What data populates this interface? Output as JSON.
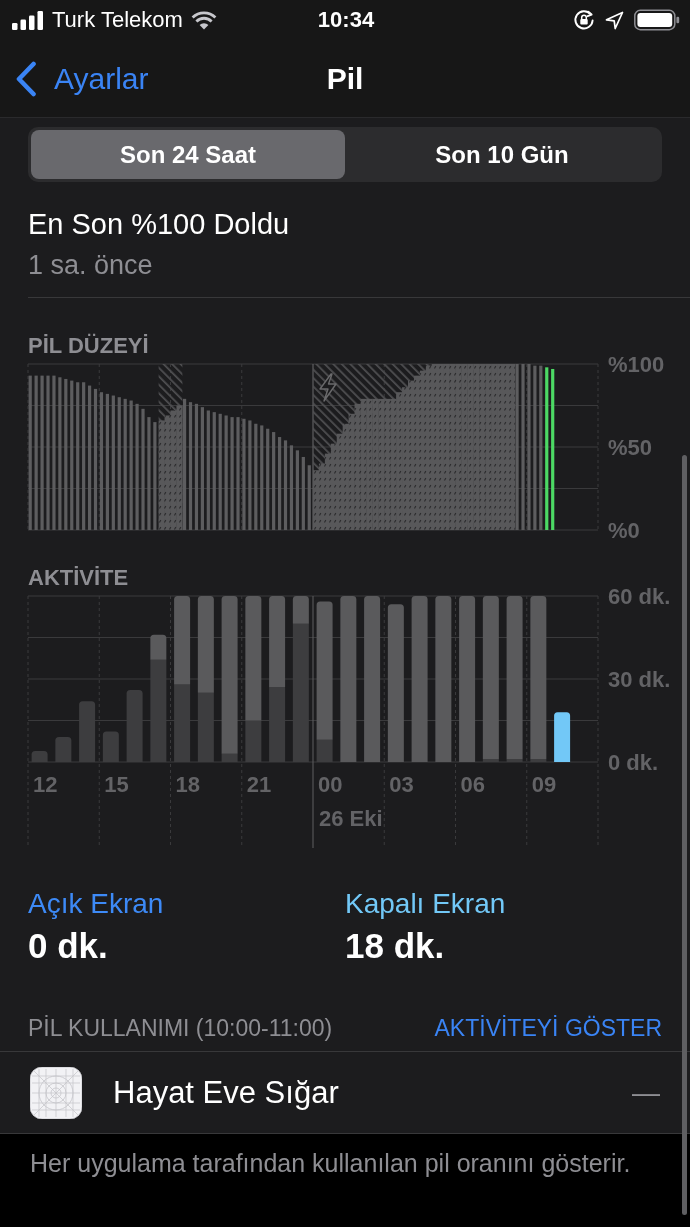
{
  "status_bar": {
    "carrier": "Turk Telekom",
    "time": "10:34"
  },
  "nav": {
    "back": "Ayarlar",
    "title": "Pil"
  },
  "segments": [
    {
      "label": "Son 24 Saat",
      "selected": true
    },
    {
      "label": "Son 10 Gün",
      "selected": false
    }
  ],
  "last_charge": {
    "title": "En Son %100 Doldu",
    "subtitle": "1 sa. önce"
  },
  "battery_level": {
    "title": "PİL DÜZEYİ",
    "chart_data": {
      "type": "bar",
      "stacked": true,
      "ylim": [
        0,
        100
      ],
      "yticks": [
        {
          "value": 100,
          "label": "%100"
        },
        {
          "value": 50,
          "label": "%50"
        },
        {
          "value": 0,
          "label": "%0"
        }
      ],
      "series": [
        {
          "color": "#5d5d5f",
          "values": [
            93,
            93,
            93,
            93,
            93,
            92,
            91,
            90,
            89,
            89,
            87,
            85,
            83,
            82,
            81,
            80,
            79,
            78,
            76,
            73,
            68,
            65,
            null,
            null,
            null,
            null,
            79,
            77,
            76,
            74,
            72,
            71,
            70,
            69,
            68,
            68,
            67,
            66,
            64,
            63,
            61,
            59,
            56,
            54,
            51,
            48,
            44,
            39,
            null,
            null,
            null,
            null,
            null,
            null,
            null,
            null,
            null,
            null,
            null,
            null,
            null,
            null,
            null,
            null,
            null,
            null,
            null,
            null,
            null,
            null,
            null,
            null,
            null,
            null,
            null,
            null,
            null,
            null,
            null,
            null,
            null,
            null,
            100,
            100,
            100,
            99,
            99,
            null,
            null,
            null,
            null,
            null,
            null,
            null,
            null,
            null
          ]
        },
        {
          "color": "#58585a",
          "values": [
            null,
            null,
            null,
            null,
            null,
            null,
            null,
            null,
            null,
            null,
            null,
            null,
            null,
            null,
            null,
            null,
            null,
            null,
            null,
            null,
            null,
            null,
            66,
            69,
            72,
            75,
            null,
            null,
            null,
            null,
            null,
            null,
            null,
            null,
            null,
            null,
            null,
            null,
            null,
            null,
            null,
            null,
            null,
            null,
            null,
            null,
            null,
            null,
            36,
            40,
            46,
            52,
            58,
            64,
            70,
            76,
            79,
            79,
            79,
            79,
            79,
            79,
            83,
            86,
            90,
            93,
            96,
            99,
            100,
            100,
            100,
            100,
            100,
            100,
            100,
            100,
            100,
            100,
            100,
            100,
            100,
            100,
            null,
            null,
            null,
            null,
            null,
            null,
            null,
            null,
            null,
            null,
            null,
            null,
            null,
            null
          ]
        },
        {
          "color": "#4cd964",
          "values": [
            null,
            null,
            null,
            null,
            null,
            null,
            null,
            null,
            null,
            null,
            null,
            null,
            null,
            null,
            null,
            null,
            null,
            null,
            null,
            null,
            null,
            null,
            null,
            null,
            null,
            null,
            null,
            null,
            null,
            null,
            null,
            null,
            null,
            null,
            null,
            null,
            null,
            null,
            null,
            null,
            null,
            null,
            null,
            null,
            null,
            null,
            null,
            null,
            null,
            null,
            null,
            null,
            null,
            null,
            null,
            null,
            null,
            null,
            null,
            null,
            null,
            null,
            null,
            null,
            null,
            null,
            null,
            null,
            null,
            null,
            null,
            null,
            null,
            null,
            null,
            null,
            null,
            null,
            null,
            null,
            null,
            null,
            null,
            null,
            null,
            null,
            null,
            98,
            97,
            null,
            null,
            null,
            null,
            null,
            null,
            null
          ]
        }
      ]
    }
  },
  "activity": {
    "title": "AKTİVİTE",
    "chart_data": {
      "type": "bar",
      "stacked": true,
      "categories": [
        "12",
        null,
        null,
        "15",
        null,
        null,
        "18",
        null,
        null,
        "21",
        null,
        null,
        "00",
        null,
        null,
        "03",
        null,
        null,
        "06",
        null,
        null,
        "09",
        null,
        null
      ],
      "ylim": [
        0,
        60
      ],
      "yticks": [
        {
          "value": 60,
          "label": "60 dk."
        },
        {
          "value": 30,
          "label": "30 dk."
        },
        {
          "value": 0,
          "label": "0 dk."
        }
      ],
      "series": [
        {
          "name": "Açık Ekran",
          "color": "#3d8af7",
          "values": [
            null,
            null,
            null,
            null,
            null,
            null,
            null,
            null,
            null,
            null,
            null,
            null,
            null,
            null,
            null,
            null,
            null,
            null,
            null,
            null,
            null,
            null,
            0,
            null
          ]
        },
        {
          "name": "Kapalı Ekran",
          "color": "#72c8f7",
          "values": [
            null,
            null,
            null,
            null,
            null,
            null,
            null,
            null,
            null,
            null,
            null,
            null,
            null,
            null,
            null,
            null,
            null,
            null,
            null,
            null,
            null,
            null,
            18,
            null
          ]
        },
        {
          "color": "#3d3d3f",
          "values": [
            4,
            9,
            22,
            11,
            26,
            37,
            28,
            25,
            3,
            15,
            27,
            50,
            8,
            0,
            0,
            0,
            0,
            0,
            0,
            1,
            1,
            1,
            null,
            null
          ]
        },
        {
          "color": "#5a5a5c",
          "values": [
            0,
            0,
            0,
            0,
            0,
            9,
            32,
            35,
            57,
            45,
            33,
            10,
            50,
            60,
            60,
            57,
            60,
            60,
            60,
            59,
            59,
            59,
            null,
            null
          ]
        }
      ],
      "annotations": [
        "26 Eki"
      ]
    }
  },
  "summary": [
    {
      "value": "0 dk."
    },
    {
      "value": "18 dk."
    }
  ],
  "usage": {
    "title": "PİL KULLANIMI (10:00-11:00)",
    "action": "AKTİVİTEYİ GÖSTER",
    "apps": [
      {
        "name": "Hayat Eve Sığar",
        "usage": "—"
      }
    ]
  },
  "footer": "Her uygulama tarafından kullanılan pil oranını gösterir."
}
